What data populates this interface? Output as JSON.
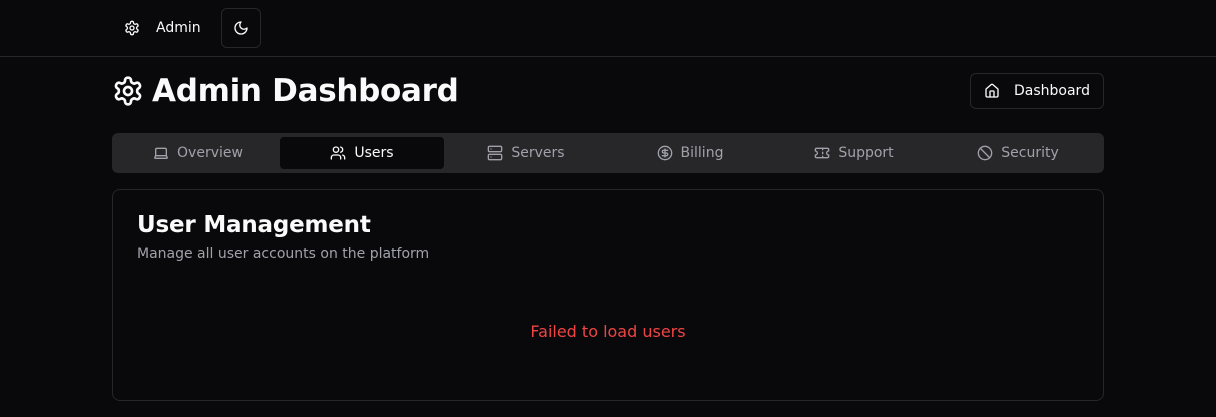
{
  "nav": {
    "admin_label": "Admin",
    "admin_icon": "gear-icon",
    "theme_icon": "moon-icon"
  },
  "header": {
    "title": "Admin Dashboard",
    "title_icon": "gear-icon",
    "dashboard_button": "Dashboard",
    "dashboard_icon": "home-icon"
  },
  "tabs": [
    {
      "label": "Overview",
      "icon": "laptop-icon",
      "active": false
    },
    {
      "label": "Users",
      "icon": "users-icon",
      "active": true
    },
    {
      "label": "Servers",
      "icon": "server-icon",
      "active": false
    },
    {
      "label": "Billing",
      "icon": "dollar-circle-icon",
      "active": false
    },
    {
      "label": "Support",
      "icon": "ticket-icon",
      "active": false
    },
    {
      "label": "Security",
      "icon": "ban-icon",
      "active": false
    }
  ],
  "card": {
    "title": "User Management",
    "description": "Manage all user accounts on the platform",
    "error": "Failed to load users"
  },
  "colors": {
    "background": "#09090b",
    "border": "#27272a",
    "muted_text": "#a1a1aa",
    "error": "#ef4444"
  }
}
